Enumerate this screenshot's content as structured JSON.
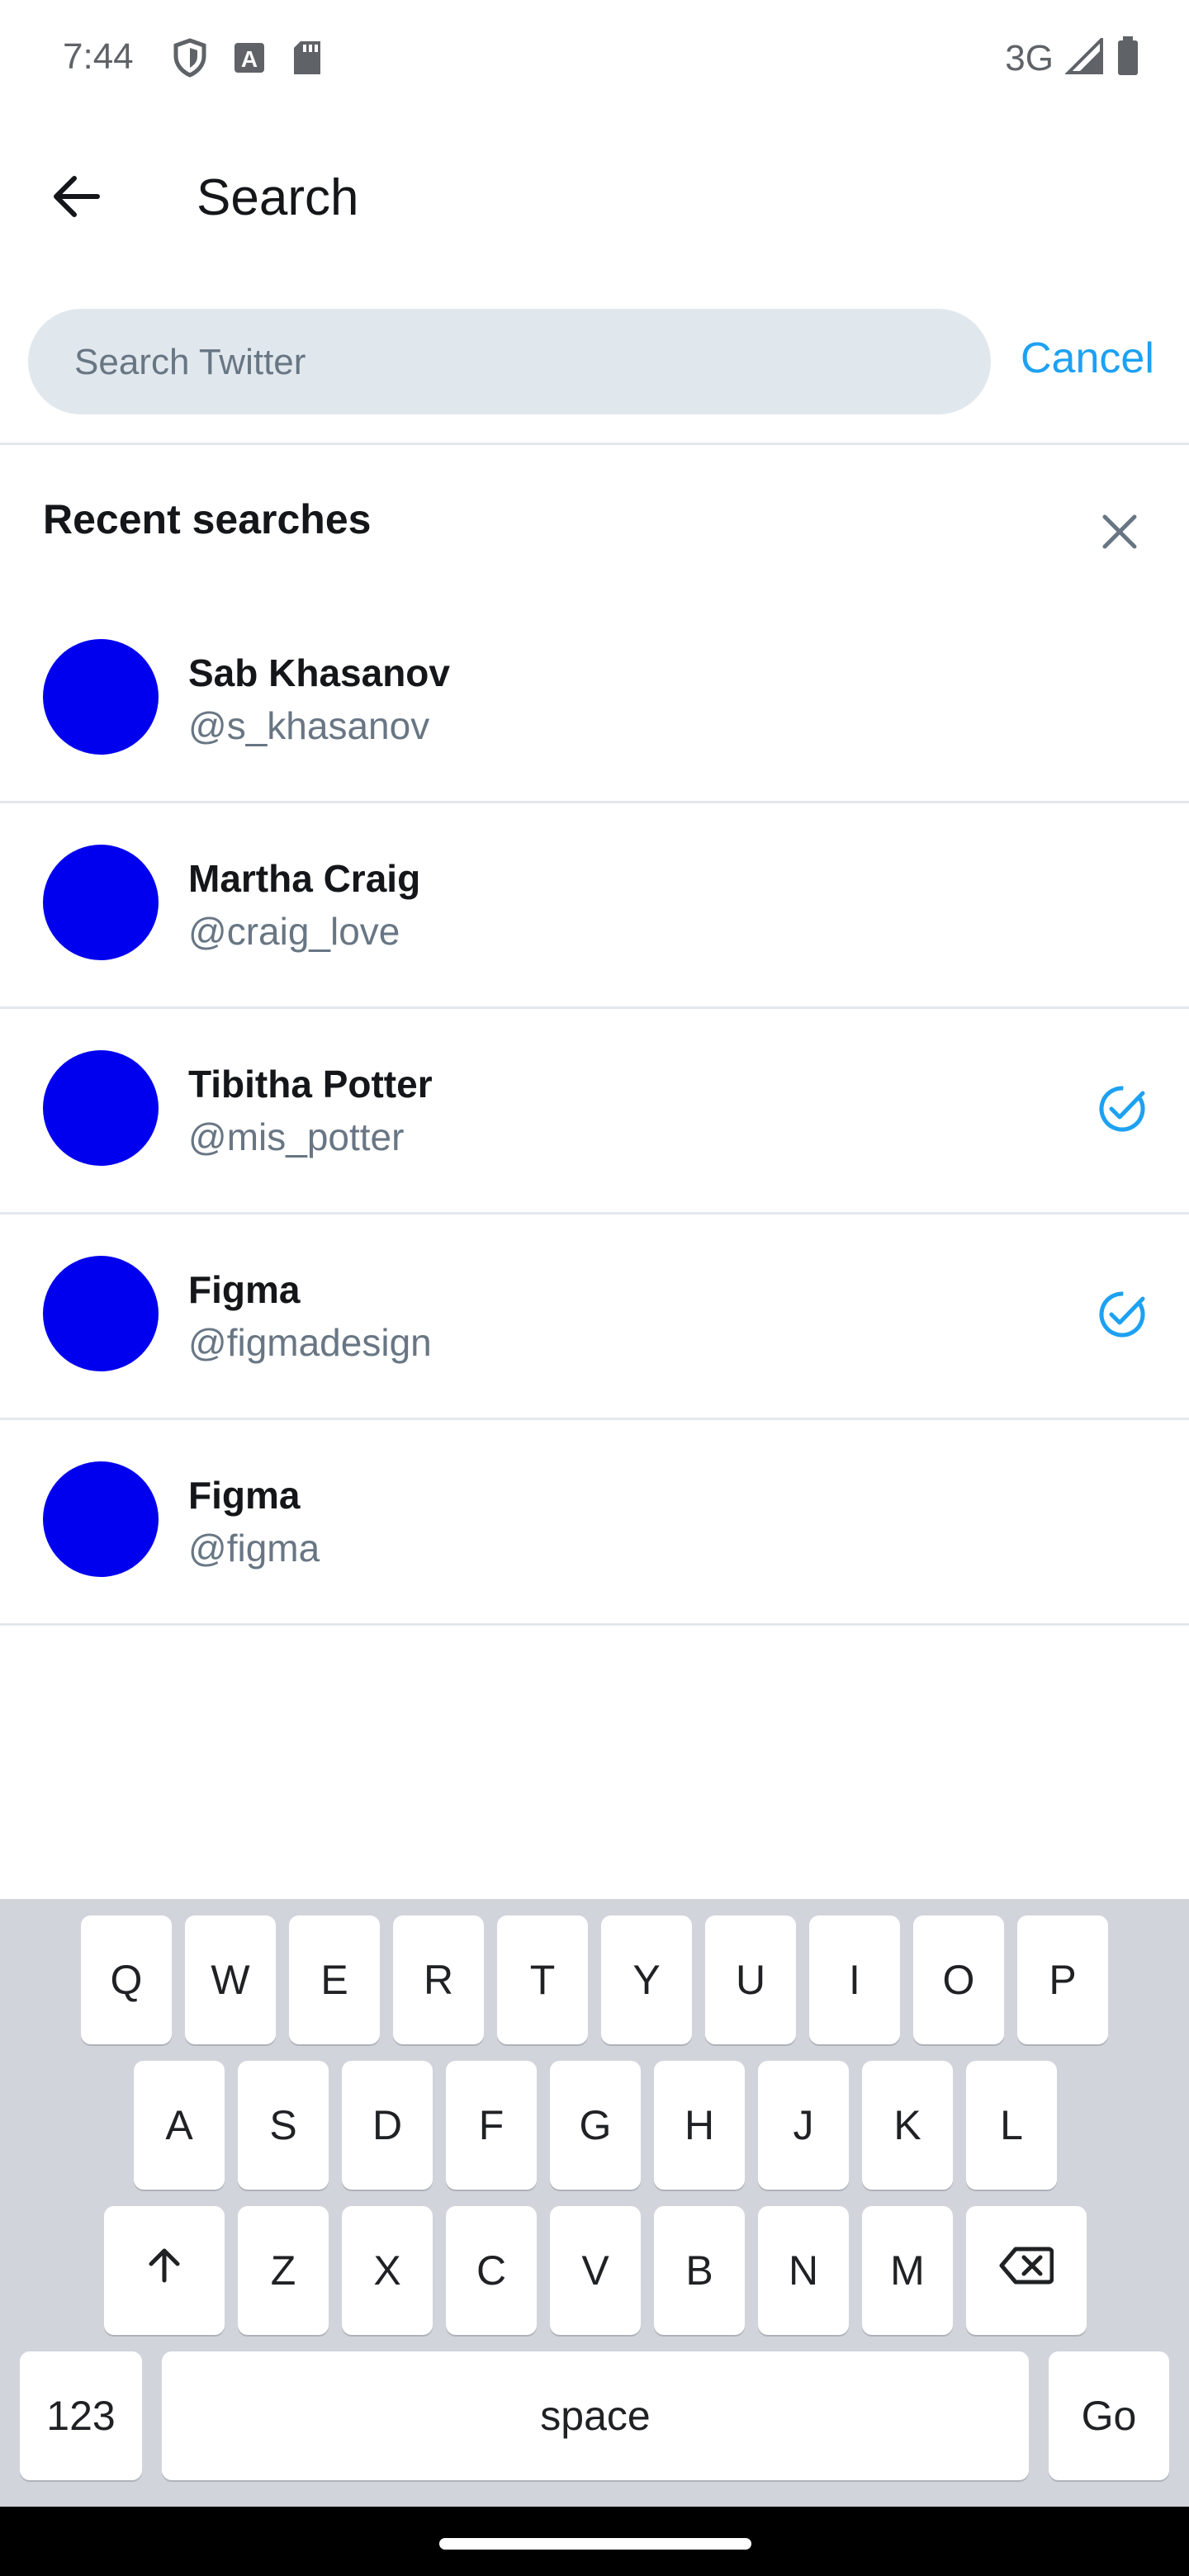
{
  "status_bar": {
    "time": "7:44",
    "network": "3G",
    "icons_left": [
      "shield-icon",
      "font-a-icon",
      "sd-card-icon"
    ],
    "icons_right": [
      "signal-icon",
      "battery-icon"
    ]
  },
  "appbar": {
    "title": "Search",
    "back_icon": "arrow-left-icon"
  },
  "search": {
    "placeholder": "Search Twitter",
    "value": "",
    "cancel_label": "Cancel"
  },
  "recent": {
    "title": "Recent searches",
    "clear_icon": "close-icon",
    "items": [
      {
        "name": "Sab Khasanov",
        "handle": "@s_khasanov",
        "verified": false
      },
      {
        "name": "Martha Craig",
        "handle": "@craig_love",
        "verified": false
      },
      {
        "name": "Tibitha Potter",
        "handle": "@mis_potter",
        "verified": true
      },
      {
        "name": "Figma",
        "handle": "@figmadesign",
        "verified": true
      },
      {
        "name": "Figma",
        "handle": "@figma",
        "verified": false
      }
    ]
  },
  "keyboard": {
    "row1": [
      "Q",
      "W",
      "E",
      "R",
      "T",
      "Y",
      "U",
      "I",
      "O",
      "P"
    ],
    "row2": [
      "A",
      "S",
      "D",
      "F",
      "G",
      "H",
      "J",
      "K",
      "L"
    ],
    "row3": [
      "Z",
      "X",
      "C",
      "V",
      "B",
      "N",
      "M"
    ],
    "shift_icon": "shift-arrow-icon",
    "backspace_icon": "backspace-icon",
    "numbers_label": "123",
    "space_label": "space",
    "action_label": "Go"
  },
  "colors": {
    "accent": "#1da1f2",
    "avatar": "#0000ee",
    "search_bg": "#e1e8ed",
    "secondary_text": "#687684",
    "keyboard_bg": "#d1d4da"
  }
}
